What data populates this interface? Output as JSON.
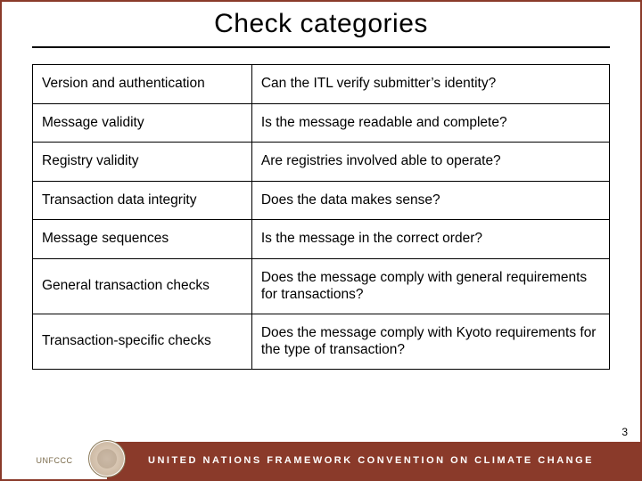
{
  "title": "Check categories",
  "rows": [
    {
      "category": "Version and authentication",
      "question": "Can the ITL verify submitter’s identity?"
    },
    {
      "category": "Message validity",
      "question": "Is the message readable and complete?"
    },
    {
      "category": "Registry validity",
      "question": "Are registries involved able to operate?"
    },
    {
      "category": "Transaction data integrity",
      "question": "Does the data makes sense?"
    },
    {
      "category": "Message sequences",
      "question": "Is the message in the correct order?"
    },
    {
      "category": "General transaction checks",
      "question": "Does the message comply with general requirements for transactions?"
    },
    {
      "category": "Transaction-specific checks",
      "question": "Does the message comply with Kyoto requirements for the type of transaction?"
    }
  ],
  "footer": {
    "logo_text": "UNFCCC",
    "banner": "UNITED NATIONS FRAMEWORK CONVENTION ON CLIMATE CHANGE"
  },
  "page_number": "3"
}
